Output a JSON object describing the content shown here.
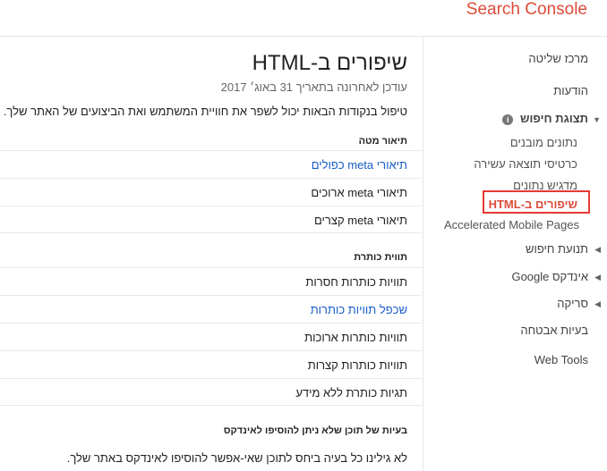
{
  "header": {
    "brand": "Search Console"
  },
  "sidebar": {
    "dashboard": "מרכז שליטה",
    "messages": "הודעות",
    "search_appearance": "תצוגת חיפוש",
    "info_icon": "i",
    "structured_data": "נתונים מובנים",
    "rich_cards": "כרטיסי תוצאה עשירה",
    "data_highlighter": "מדגיש נתונים",
    "html_improvements": "שיפורים ב-HTML",
    "amp": "Accelerated Mobile Pages",
    "search_traffic": "תנועת חיפוש",
    "google_index": "אינדקס Google",
    "crawl": "סריקה",
    "security_issues": "בעיות אבטחה",
    "web_tools": "Web Tools",
    "icons": {
      "collapse": "triangle-down-icon",
      "expand": "triangle-left-icon",
      "info": "info-icon"
    }
  },
  "main": {
    "title": "שיפורים ב-HTML",
    "updated": "עודכן לאחרונה בתאריך 31 באוג׳ 2017",
    "intro": "טיפול בנקודות הבאות יכול לשפר את חוויית המשתמש ואת הביצועים של האתר שלך.",
    "meta_section": {
      "heading": "תיאור מטה",
      "rows": [
        {
          "label": "תיאורי meta כפולים",
          "link": true
        },
        {
          "label": "תיאורי meta ארוכים",
          "link": false
        },
        {
          "label": "תיאורי meta קצרים",
          "link": false
        }
      ]
    },
    "title_section": {
      "heading": "תווית כותרת",
      "rows": [
        {
          "label": "תוויות כותרות חסרות",
          "link": false
        },
        {
          "label": "שכפל תוויות כותרות",
          "link": true
        },
        {
          "label": "תוויות כותרות ארוכות",
          "link": false
        },
        {
          "label": "תוויות כותרות קצרות",
          "link": false
        },
        {
          "label": "תגיות כותרת ללא מידע",
          "link": false
        }
      ]
    },
    "nonindexable_section": {
      "heading": "בעיות של תוכן שלא ניתן להוסיפו לאינדקס",
      "text": "לא גילינו כל בעיה ביחס לתוכן שאי-אפשר להוסיפו לאינדקס באתר שלך."
    }
  },
  "colors": {
    "brand": "#dd4b39",
    "link": "#1a5dc8",
    "highlight": "#e53935"
  }
}
